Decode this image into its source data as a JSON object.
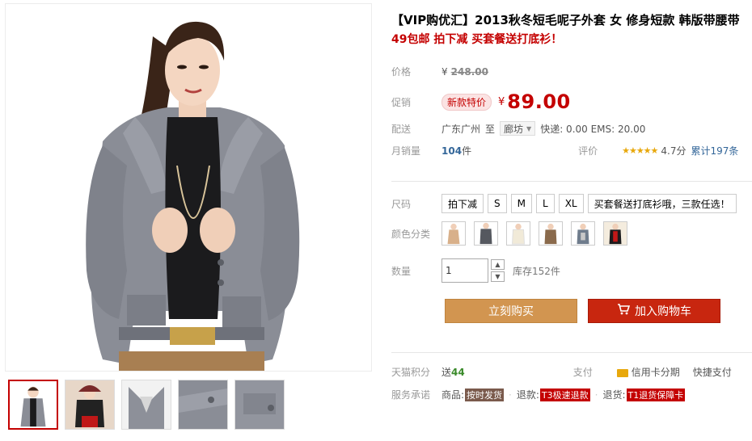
{
  "product": {
    "title": "【VIP购优汇】2013秋冬短毛呢子外套 女 修身短款 韩版带腰带",
    "subtitle": "49包邮 拍下减 买套餐送打底衫！"
  },
  "price": {
    "label": "价格",
    "currency": "¥",
    "original": "248.00",
    "promo_label": "促销",
    "promo_tag": "新款特价",
    "current": "89.00"
  },
  "shipping": {
    "label": "配送",
    "from": "广东广州",
    "to_word": "至",
    "destination": "廊坊",
    "express": "快递: 0.00 EMS: 20.00"
  },
  "sales": {
    "label": "月销量",
    "count": "104",
    "unit": "件",
    "rating_label": "评价",
    "stars": "★★★★★",
    "score": "4.7分",
    "reviews": "累计197条"
  },
  "size": {
    "label": "尺码",
    "options": [
      "拍下减",
      "S",
      "M",
      "L",
      "XL",
      "买套餐送打底衫哦，三款任选！"
    ]
  },
  "color": {
    "label": "颜色分类",
    "swatches": [
      "camel-coat",
      "grey-coat",
      "white-coat",
      "brown-coat",
      "plaid-coat",
      "black-red-coat"
    ]
  },
  "quantity": {
    "label": "数量",
    "value": "1",
    "stock": "库存152件"
  },
  "actions": {
    "buy": "立刻购买",
    "cart": "加入购物车"
  },
  "services": {
    "points_label": "天猫积分",
    "points_prefix": "送",
    "points": "44",
    "pay_label": "支付",
    "credit": "信用卡分期",
    "quick_pay": "快捷支付",
    "promise_label": "服务承诺",
    "goods": "商品:",
    "goods_tag": "按时发货",
    "refund": "退款:",
    "refund_tag": "T3极速退款",
    "return": "退货:",
    "return_tag": "T1退货保障卡"
  },
  "colors": {
    "accent_red": "#c40000",
    "buy_orange": "#d29550",
    "cart_red": "#c8260f"
  }
}
